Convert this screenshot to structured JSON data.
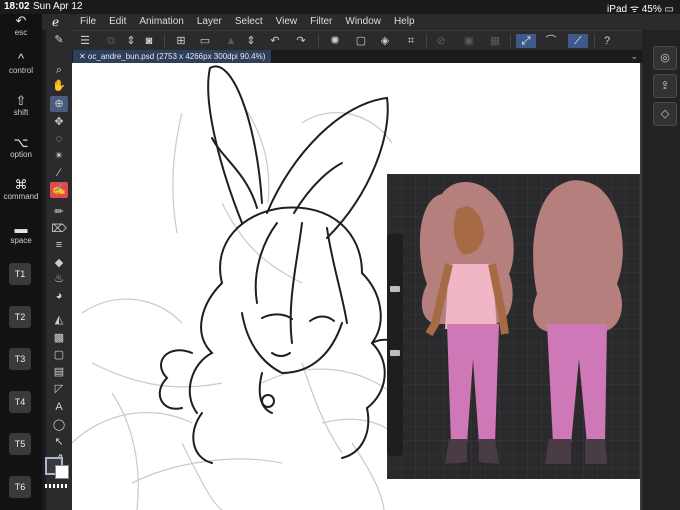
{
  "status": {
    "time": "18:02",
    "date": "Sun Apr 12",
    "right": "iPad ᯤ 45% ▭"
  },
  "menu": {
    "items": [
      "File",
      "Edit",
      "Animation",
      "Layer",
      "Select",
      "View",
      "Filter",
      "Window",
      "Help"
    ]
  },
  "tab": {
    "label": "✕ oc_andre_bun.psd (2753 x 4266px 300dpi 90.4%)"
  },
  "leftpanel": {
    "keys": [
      {
        "label": "esc",
        "symbol": "↶"
      },
      {
        "label": "control",
        "symbol": "^"
      },
      {
        "label": "shift",
        "symbol": "⇧"
      },
      {
        "label": "option",
        "symbol": "⌥"
      },
      {
        "label": "command",
        "symbol": "⌘"
      },
      {
        "label": "space",
        "symbol": "▬"
      }
    ],
    "tbuttons": [
      "T1",
      "T2",
      "T3",
      "T4",
      "T5",
      "T6"
    ]
  },
  "colors": {
    "accent": "#3f5a8a",
    "selected_tool": "#e4484f",
    "skin": "#a66b45",
    "hair": "#b57f7d",
    "vest": "#f0b6c6",
    "pants": "#cf78b7"
  }
}
